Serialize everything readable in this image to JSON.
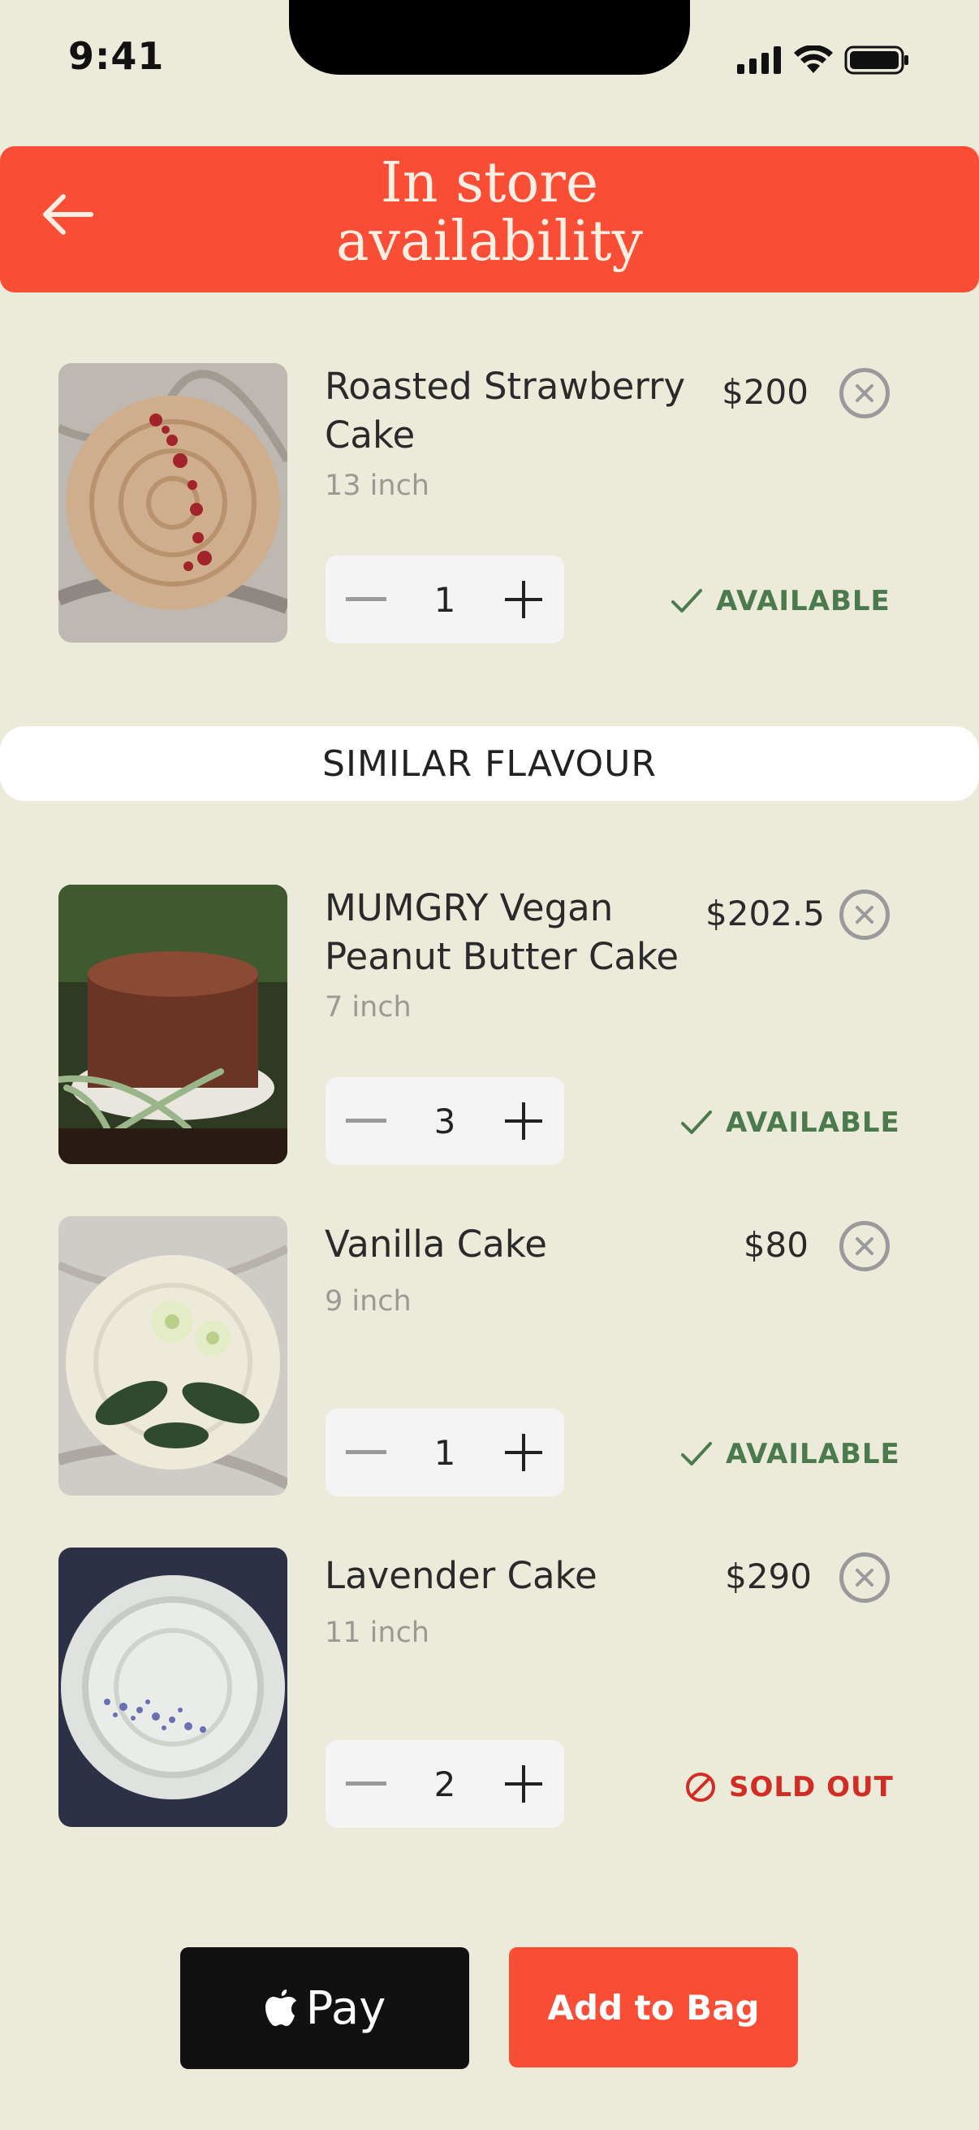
{
  "status_bar": {
    "time": "9:41"
  },
  "header": {
    "title_line1": "In store",
    "title_line2": "availability"
  },
  "featured": {
    "name": "Roasted Strawberry Cake",
    "size": "13 inch",
    "price": "$200",
    "qty": "1",
    "status": "AVAILABLE"
  },
  "section": {
    "label": "SIMILAR FLAVOUR"
  },
  "similar": [
    {
      "name": "MUMGRY Vegan Peanut Butter Cake",
      "size": "7 inch",
      "price": "$202.5",
      "qty": "3",
      "status": "AVAILABLE"
    },
    {
      "name": "Vanilla Cake",
      "size": "9 inch",
      "price": "$80",
      "qty": "1",
      "status": "AVAILABLE"
    },
    {
      "name": "Lavender Cake",
      "size": "11 inch",
      "price": "$290",
      "qty": "2",
      "status": "SOLD OUT"
    }
  ],
  "actions": {
    "apple_pay_label": "Pay",
    "add_to_bag_label": "Add to Bag"
  },
  "colors": {
    "brand": "#fa4d36",
    "background": "#ecead9",
    "available": "#4a7a4d",
    "sold_out": "#d12d25"
  }
}
